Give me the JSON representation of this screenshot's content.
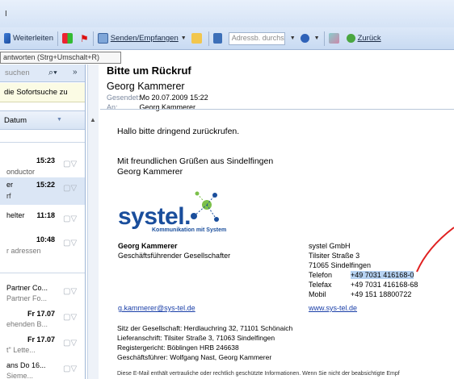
{
  "toolbar_top": {
    "caret": "I"
  },
  "toolbar": {
    "forward": "Weiterleiten",
    "send_receive": "Senden/Empfangen",
    "addr_search": "Adressb. durchsuchen",
    "back": "Zurück"
  },
  "tooltip": "antworten (Strg+Umschalt+R)",
  "list": {
    "search_placeholder": "suchen",
    "instant_search": "die Sofortsuche zu",
    "column_date": "Datum",
    "items": [
      {
        "time": "15:23",
        "line2": "onductor"
      },
      {
        "time": "15:22",
        "line1": "er",
        "line2": "rf"
      },
      {
        "time": "11:18",
        "line1": "helter"
      },
      {
        "time": "10:48",
        "line2": "r adressen"
      },
      {
        "line1": "Partner Co...",
        "line2": "Partner Fo..."
      },
      {
        "time": "Fr 17.07",
        "line2": "ehenden B..."
      },
      {
        "time": "Fr 17.07",
        "line2": "t\" Lette..."
      },
      {
        "line1": "ans Do 16...",
        "line2": "Sieme..."
      }
    ]
  },
  "mail": {
    "subject": "Bitte um Rückruf",
    "sender": "Georg Kammerer",
    "sent_label": "Gesendet:",
    "sent_value": "Mo 20.07.2009 15:22",
    "to_label": "An:",
    "to_value": "Georg Kammerer",
    "greeting": "Hallo bitte dringend zurückrufen.",
    "closing1": "Mit freundlichen Grüßen aus Sindelfingen",
    "closing2": "Georg Kammerer",
    "logo_word": "systel.",
    "logo_claim": "Kommunikation mit System",
    "sig_name": "Georg Kammerer",
    "sig_title": "Geschäftsführender Gesellschafter",
    "company": "systel GmbH",
    "street": "Tilsiter Straße 3",
    "city": "71065 Sindelfingen",
    "phone_label": "Telefon",
    "phone_value": "+49 7031 416168-0",
    "fax_label": "Telefax",
    "fax_value": "+49 7031 416168-68",
    "mobile_label": "Mobil",
    "mobile_value": "+49 151 18800722",
    "email": "g.kammerer@sys-tel.de",
    "web": "www.sys-tel.de",
    "legal1": "Sitz der Gesellschaft: Herdlauchring 32, 71101 Schönaich",
    "legal2": "Lieferanschrift: Tilsiter Straße 3, 71063 Sindelfingen",
    "legal3": "Registergericht: Böblingen HRB 246638",
    "legal4": "Geschäftsführer: Wolfgang Nast, Georg Kammerer",
    "disclaimer": "Diese E-Mail enthält vertrauliche oder rechtlich geschützte Informationen. Wenn Sie nicht der beabsichtigte Empf"
  },
  "colors": {
    "accent": "#1a4e9c",
    "highlight": "#b7d3f2",
    "annotation": "#e02020"
  }
}
